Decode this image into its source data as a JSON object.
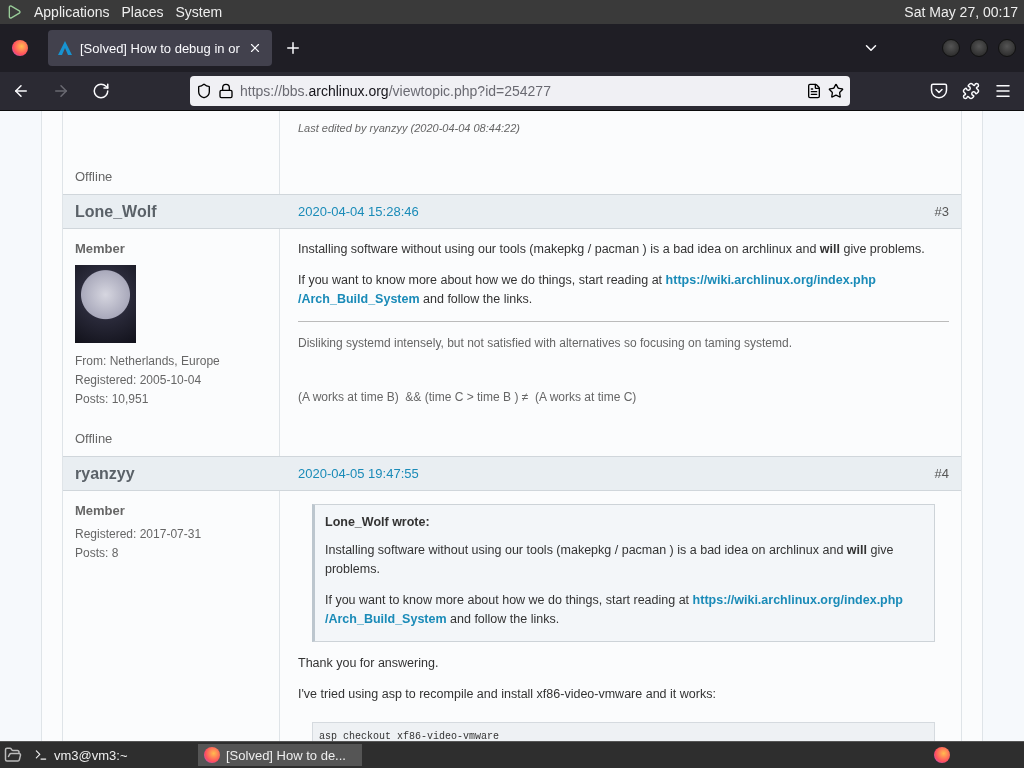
{
  "top_panel": {
    "menus": [
      "Applications",
      "Places",
      "System"
    ],
    "clock": "Sat May 27, 00:17"
  },
  "browser": {
    "tabs": [
      {
        "title": "[Solved] How to debug in or",
        "selected": true
      }
    ],
    "nav_buttons": [
      {
        "kind": "back",
        "disabled": false
      },
      {
        "kind": "forward",
        "disabled": true
      },
      {
        "kind": "reload",
        "disabled": false
      }
    ],
    "url": {
      "prefix": "https://bbs.",
      "domain": "archlinux.org",
      "path": "/viewtopic.php?id=254277"
    }
  },
  "prev_post": {
    "edited": "Last edited by ryanzyy (2020-04-04 08:44:22)",
    "status": "Offline"
  },
  "posts": [
    {
      "author": "Lone_Wolf",
      "date": "2020-04-04 15:28:46",
      "number": "#3",
      "role": "Member",
      "avatar": true,
      "info": [
        "From: Netherlands, Europe",
        "Registered: 2005-10-04",
        "Posts: 10,951"
      ],
      "status": "Offline",
      "paragraphs": [
        {
          "text": "Installing software without using our tools (makepkg / pacman ) is a bad idea on archlinux and **will** give problems."
        },
        {
          "text": "If you want to know more about how we do things, start reading at ",
          "link": [
            "https://wiki.archlinux.org/index.php",
            "/Arch_Build_System"
          ],
          "after": " and follow the links."
        }
      ],
      "signature": [
        "Disliking systemd intensely, but not satisfied with alternatives so focusing on taming systemd.",
        "(A works at time B)  && (time C > time B ) ≠  (A works at time C)"
      ]
    },
    {
      "author": "ryanzyy",
      "date": "2020-04-05 19:47:55",
      "number": "#4",
      "role": "Member",
      "info": [
        "Registered: 2017-07-31",
        "Posts: 8"
      ],
      "quote": {
        "author": "Lone_Wolf wrote:",
        "paragraphs": [
          {
            "text": "Installing software without using our tools (makepkg / pacman ) is a bad idea on archlinux and **will** give problems."
          },
          {
            "text": "If you want to know more about how we do things, start reading at ",
            "link": [
              "https://wiki.archlinux.org/index.php",
              "/Arch_Build_System"
            ],
            "after": " and follow the links."
          }
        ]
      },
      "paragraphs": [
        {
          "text": "Thank you for answering."
        },
        {
          "text": "I've tried using asp to recompile and install xf86-video-vmware and it works:"
        }
      ],
      "code": "asp checkout xf86-video-vmware"
    }
  ],
  "taskbar": {
    "items": [
      {
        "kind": "terminal",
        "label": "vm3@vm3:~",
        "selected": false
      },
      {
        "kind": "browser",
        "label": "[Solved] How to de...",
        "selected": true
      }
    ]
  }
}
